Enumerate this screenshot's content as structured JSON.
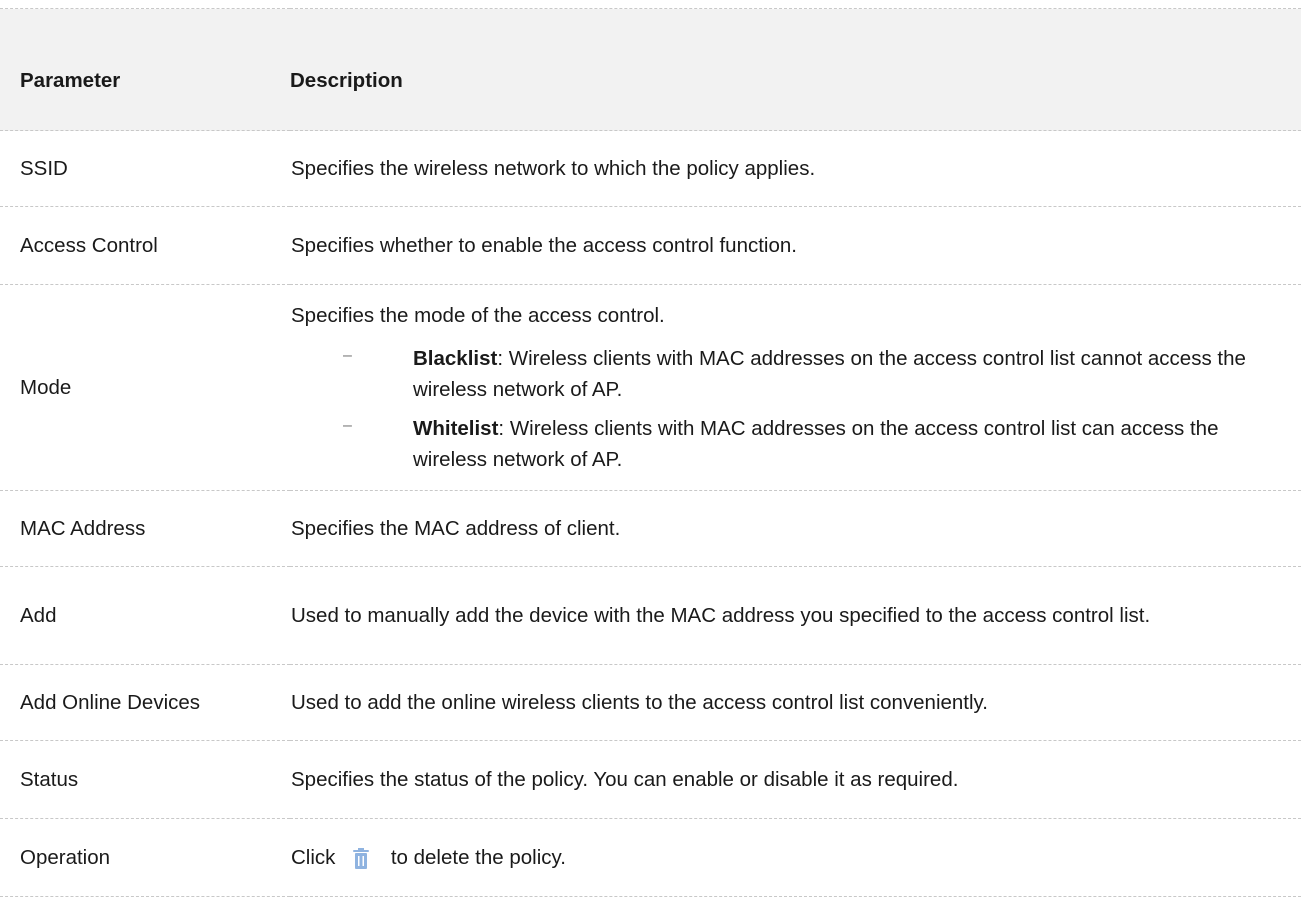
{
  "table": {
    "header": {
      "parameter": "Parameter",
      "description": "Description"
    },
    "rows": {
      "ssid": {
        "name": "SSID",
        "description": "Specifies the wireless network to which the policy applies."
      },
      "access_control": {
        "name": "Access Control",
        "description": "Specifies whether to enable the access control function."
      },
      "mode": {
        "name": "Mode",
        "intro": "Specifies the mode of the access control.",
        "options": [
          {
            "term": "Blacklist",
            "text": ": Wireless clients with MAC addresses on the access control list cannot access the wireless network of AP."
          },
          {
            "term": "Whitelist",
            "text": ": Wireless clients with MAC addresses on the access control list can access the wireless network of AP."
          }
        ],
        "bullet": "–"
      },
      "mac_address": {
        "name": "MAC Address",
        "description": "Specifies the MAC address of client."
      },
      "add": {
        "name": "Add",
        "description": "Used to manually add the device with the MAC address you specified to the access control list."
      },
      "add_online_devices": {
        "name": "Add Online Devices",
        "description": "Used to add the online wireless clients to the access control list conveniently."
      },
      "status": {
        "name": "Status",
        "description": "Specifies the status of the policy. You can enable or disable it as required."
      },
      "operation": {
        "name": "Operation",
        "before_icon": "Click",
        "after_icon": "to delete the policy.",
        "icon": "trash-icon",
        "icon_color": "#8fb3e0"
      }
    }
  },
  "colors": {
    "header_bg": "#f2f2f2",
    "divider": "#c8c8c8",
    "text": "#1a1a1a"
  }
}
